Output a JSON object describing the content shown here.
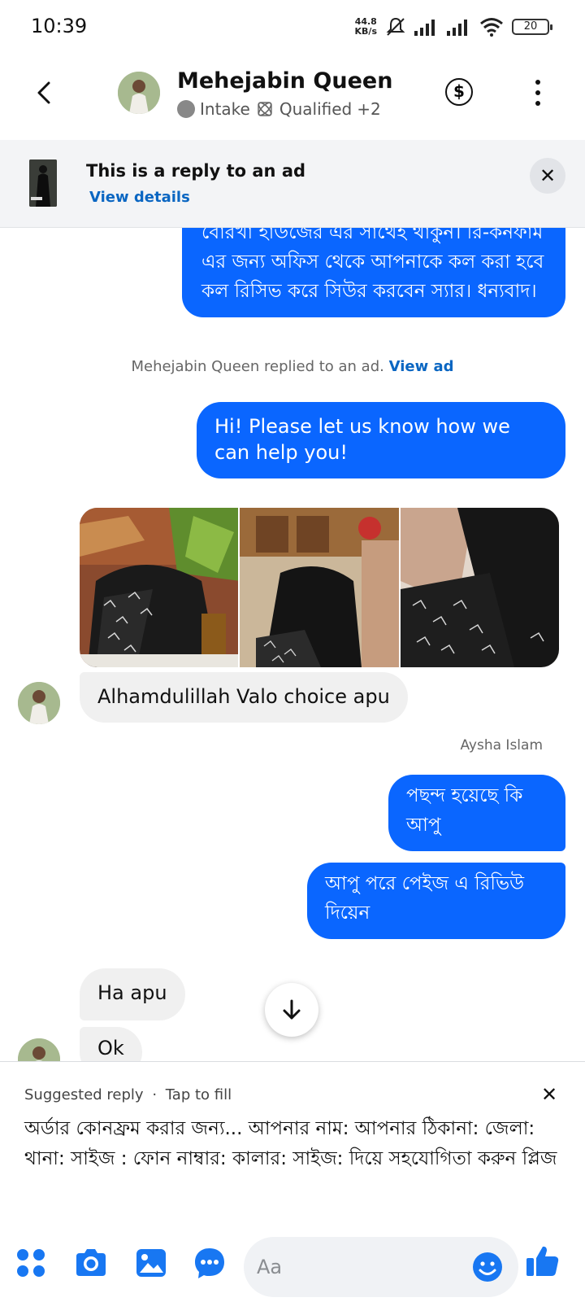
{
  "status_bar": {
    "time": "10:39",
    "net_speed_value": "44.8",
    "net_speed_unit": "KB/s",
    "battery": "20"
  },
  "header": {
    "contact_name": "Mehejabin Queen",
    "label_1": "Intake",
    "label_2": "Qualified",
    "label_more": "+2",
    "dollar_symbol": "$"
  },
  "ad_banner": {
    "title": "This is a reply to an ad",
    "link": "View details",
    "close_symbol": "✕"
  },
  "messages": {
    "out_bengali_1": "বোরখা হাউজের এর সাথেই থাকুন। রি-কনফার্ম এর জন্য অফিস থেকে আপনাকে কল করা হবে কল রিসিভ করে সিউর করবেন স্যার। ধন্যবাদ।",
    "system_text": "Mehejabin Queen replied to an ad.",
    "system_link": "View ad",
    "out_greeting": "Hi! Please let us know how we can help you!",
    "in_choice": "Alhamdulillah Valo choice apu",
    "sender_label": "Aysha Islam",
    "out_bengali_2": "পছন্দ  হয়েছে কি আপু",
    "out_bengali_3": "আপু পরে পেইজ এ রিভিউ দিয়েন",
    "in_ha": "Ha apu",
    "in_ok": "Ok"
  },
  "suggested_reply": {
    "label": "Suggested reply",
    "separator": "·",
    "hint": "Tap to fill",
    "close_symbol": "✕",
    "text": "অর্ডার কোনফ্রম করার জন্য... আপনার নাম: আপনার ঠিকানা: জেলা: থানা: সাইজ : ফোন নাম্বার: কালার: সাইজ: দিয়ে সহযোগিতা করুন প্লিজ"
  },
  "composer": {
    "placeholder": "Aa"
  },
  "colors": {
    "messenger_blue": "#0a66ff",
    "link_blue": "#0a66c2",
    "icon_blue": "#1877f2"
  }
}
